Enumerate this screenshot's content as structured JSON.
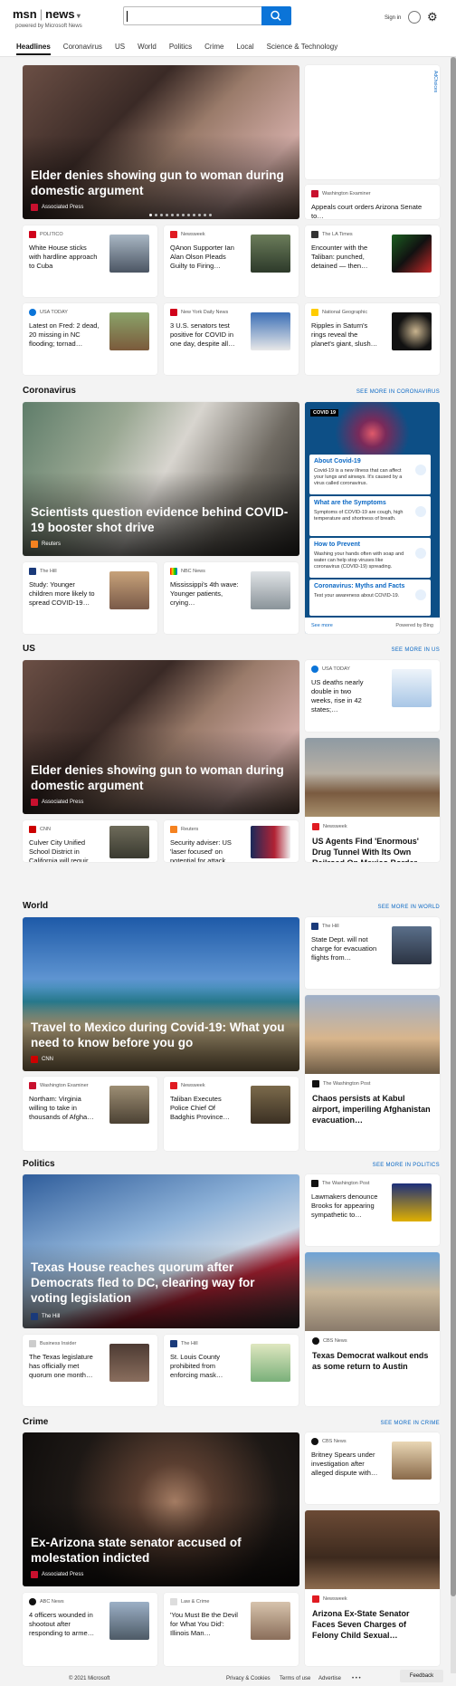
{
  "header": {
    "brand": "msn",
    "product": "news",
    "powered_by": "powered by Microsoft News",
    "search_placeholder": "",
    "sign_in": "Sign in"
  },
  "nav": [
    "Headlines",
    "Coronavirus",
    "US",
    "World",
    "Politics",
    "Crime",
    "Local",
    "Science & Technology"
  ],
  "ad_label": "AdChoices",
  "top": {
    "hero": {
      "title": "Elder denies showing gun to woman during domestic argument",
      "source": "Associated Press"
    },
    "side": {
      "source": "Washington Examiner",
      "title": "Appeals court orders Arizona Senate to…"
    },
    "row1": [
      {
        "source": "POLITICO",
        "title": "White House sticks with hardline approach to Cuba"
      },
      {
        "source": "Newsweek",
        "title": "QAnon Supporter Ian Alan Olson Pleads Guilty to Firing…"
      },
      {
        "source": "The LA Times",
        "title": "Encounter with the Taliban: punched, detained — then…"
      }
    ],
    "row2": [
      {
        "source": "USA TODAY",
        "title": "Latest on Fred: 2 dead, 20 missing in NC flooding; tornad…"
      },
      {
        "source": "New York Daily News",
        "title": "3 U.S. senators test positive for COVID in one day, despite all…"
      },
      {
        "source": "National Geographic",
        "title": "Ripples in Saturn's rings reveal the planet's giant, slush…"
      }
    ]
  },
  "coronavirus": {
    "heading": "Coronavirus",
    "see_more": "SEE MORE IN CORONAVIRUS",
    "hero": {
      "title": "Scientists question evidence behind COVID-19 booster shot drive",
      "source": "Reuters"
    },
    "row": [
      {
        "source": "The Hill",
        "title": "Study: Younger children more likely to spread COVID-19…"
      },
      {
        "source": "NBC News",
        "title": "Mississippi's 4th wave: Younger patients, crying…"
      }
    ],
    "panel": {
      "badge": "COVID 19",
      "items": [
        {
          "h": "About Covid-19",
          "d": "Covid-19 is a new illness that can affect your lungs and airways. It's caused by a virus called coronavirus."
        },
        {
          "h": "What are the Symptoms",
          "d": "Symptoms of COVID-19 are cough, high temperature and shortness of breath."
        },
        {
          "h": "How to Prevent",
          "d": "Washing your hands often with soap and water can help stop viruses like coronavirus (COVID-19) spreading."
        },
        {
          "h": "Coronavirus: Myths and Facts",
          "d": "Test your awareness about COVID-19."
        }
      ],
      "see_more": "See more",
      "powered": "Powered by Bing"
    }
  },
  "us": {
    "heading": "US",
    "see_more": "SEE MORE IN US",
    "hero": {
      "title": "Elder denies showing gun to woman during domestic argument",
      "source": "Associated Press"
    },
    "side": {
      "source": "USA TODAY",
      "title": "US deaths nearly double in two weeks, rise in 42 states;…"
    },
    "row": [
      {
        "source": "CNN",
        "title": "Culver City Unified School District in California will requir…"
      },
      {
        "source": "Reuters",
        "title": "Security adviser: US 'laser focused' on potential for attack …"
      }
    ],
    "tall": {
      "source": "Newsweek",
      "title": "US Agents Find 'Enormous' Drug Tunnel With Its Own Railroad On Mexico Border"
    }
  },
  "world": {
    "heading": "World",
    "see_more": "SEE MORE IN WORLD",
    "hero": {
      "title": "Travel to Mexico during Covid-19: What you need to know before you go",
      "source": "CNN"
    },
    "side": {
      "source": "The Hill",
      "title": "State Dept. will not charge for evacuation flights from…"
    },
    "row": [
      {
        "source": "Washington Examiner",
        "title": "Northam: Virginia willing to take in thousands of Afgha…"
      },
      {
        "source": "Newsweek",
        "title": "Taliban Executes Police Chief Of Badghis Province…"
      }
    ],
    "tall": {
      "source": "The Washington Post",
      "title": "Chaos persists at Kabul airport, imperiling Afghanistan evacuation…"
    }
  },
  "politics": {
    "heading": "Politics",
    "see_more": "SEE MORE IN POLITICS",
    "hero": {
      "title": "Texas House reaches quorum after Democrats fled to DC, clearing way for voting legislation",
      "source": "The Hill"
    },
    "side": {
      "source": "The Washington Post",
      "title": "Lawmakers denounce Brooks for appearing sympathetic to…"
    },
    "row": [
      {
        "source": "Business Insider",
        "title": "The Texas legislature has officially met quorum one month…"
      },
      {
        "source": "The Hill",
        "title": "St. Louis County prohibited from enforcing mask…"
      }
    ],
    "tall": {
      "source": "CBS News",
      "title": "Texas Democrat walkout ends as some return to Austin"
    }
  },
  "crime": {
    "heading": "Crime",
    "see_more": "SEE MORE IN CRIME",
    "hero": {
      "title": "Ex-Arizona state senator accused of molestation indicted",
      "source": "Associated Press"
    },
    "side": {
      "source": "CBS News",
      "title": "Britney Spears under investigation after alleged dispute with…"
    },
    "row": [
      {
        "source": "ABC News",
        "title": "4 officers wounded in shootout after responding to arme…"
      },
      {
        "source": "Law & Crime",
        "title": "'You Must Be the Devil for What You Did': Illinois Man…"
      }
    ],
    "tall": {
      "source": "Newsweek",
      "title": "Arizona Ex-State Senator Faces Seven Charges of Felony Child Sexual…"
    }
  },
  "footer": {
    "copyright": "© 2021 Microsoft",
    "links": [
      "Privacy & Cookies",
      "Terms of use",
      "Advertise"
    ],
    "more": "• • •",
    "feedback": "Feedback"
  }
}
